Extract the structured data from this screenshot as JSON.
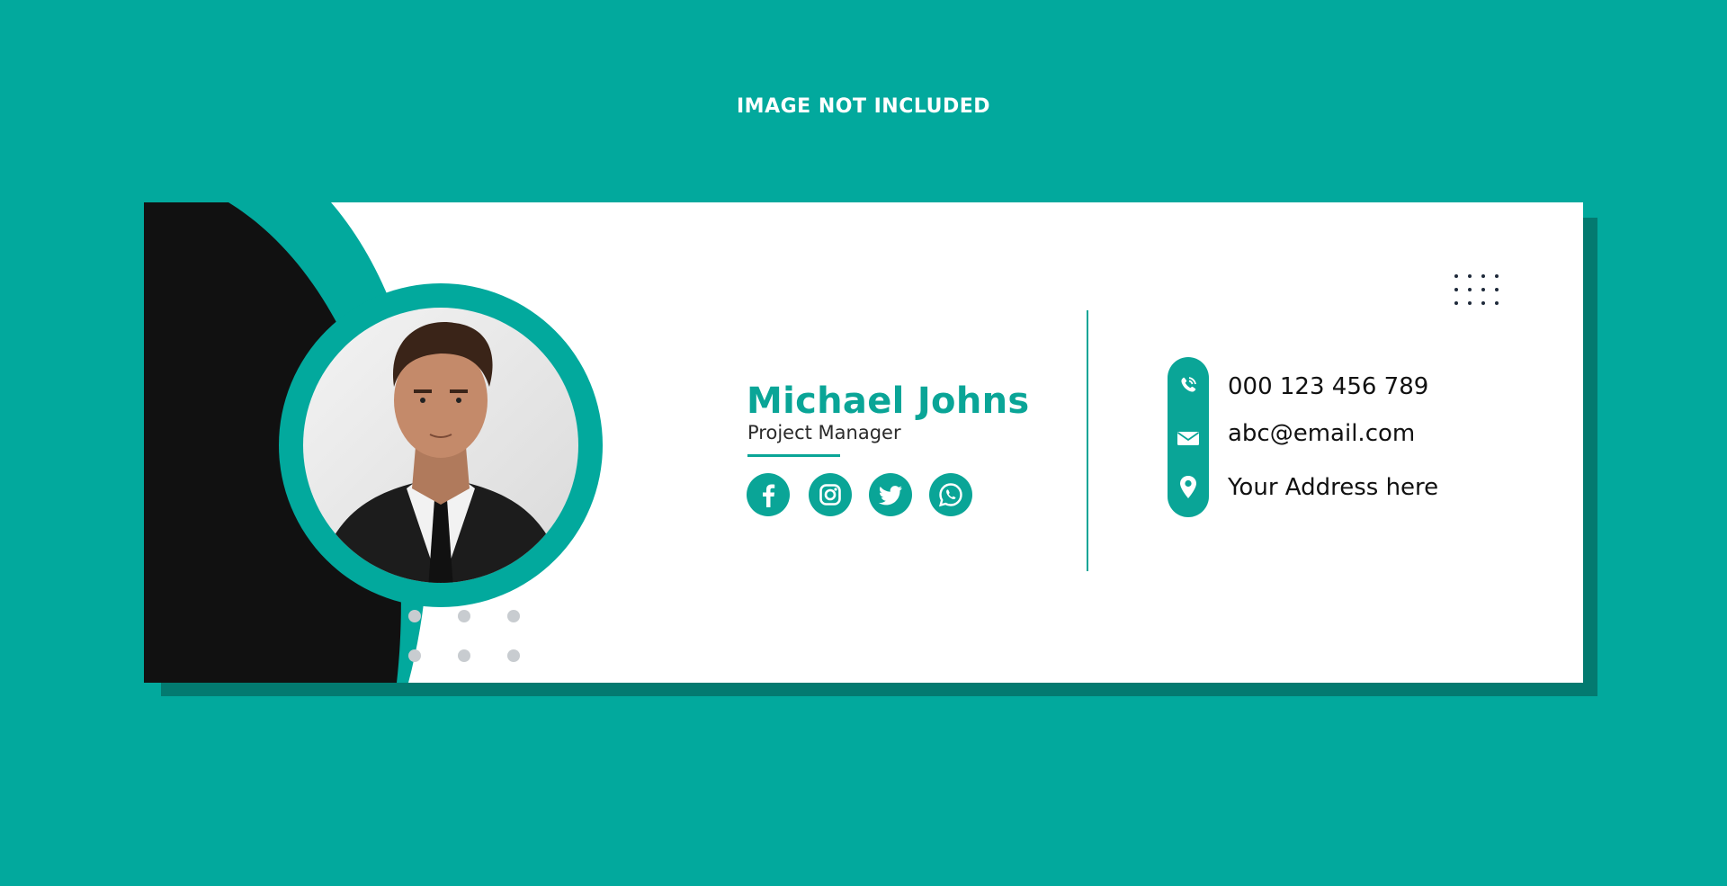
{
  "banner": {
    "text": "IMAGE NOT INCLUDED"
  },
  "signature": {
    "name": "Michael Johns",
    "title": "Project Manager",
    "photo": "portrait-photo",
    "social": [
      {
        "label": "facebook",
        "icon": "facebook-icon"
      },
      {
        "label": "instagram",
        "icon": "instagram-icon"
      },
      {
        "label": "twitter",
        "icon": "twitter-icon"
      },
      {
        "label": "whatsapp",
        "icon": "whatsapp-icon"
      }
    ],
    "contacts": {
      "phone": "000 123 456 789",
      "email": "abc@email.com",
      "address": "Your Address here"
    }
  },
  "colors": {
    "background": "#02a99d",
    "accent": "#0aa597",
    "shadow": "#037a70",
    "dark": "#111111",
    "card": "#ffffff",
    "decor_dots": "#c8ccd0"
  }
}
